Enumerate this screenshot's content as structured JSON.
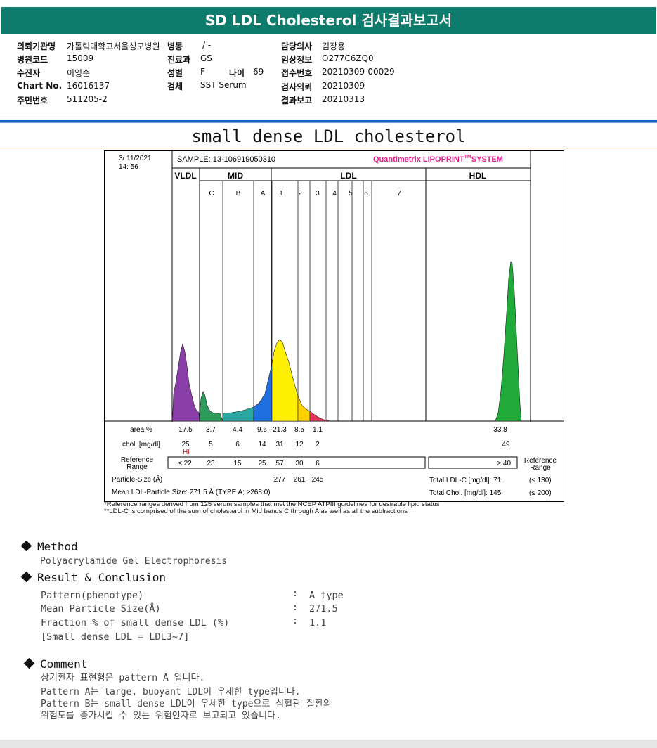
{
  "header": {
    "title": "SD LDL Cholesterol 검사결과보고서"
  },
  "info": {
    "rows": [
      [
        {
          "label": "의뢰기관명",
          "value": "가톨릭대학교서울성모병원"
        },
        {
          "label": "병동",
          "value": "/ -"
        },
        {
          "label": "담당의사",
          "value": "김장용"
        }
      ],
      [
        {
          "label": "병원코드",
          "value": "15009"
        },
        {
          "label": "진료과",
          "value": "GS"
        },
        {
          "label": "임상정보",
          "value": "O277C6ZQ0"
        }
      ],
      [
        {
          "label": "수진자",
          "value": "이영순"
        },
        {
          "label": "성별",
          "value": "F"
        },
        {
          "label": "나이",
          "value": "69"
        },
        {
          "label": "접수번호",
          "value": "20210309-00029"
        }
      ],
      [
        {
          "label": "Chart No.",
          "value": "16016137"
        },
        {
          "label": "검체",
          "value": "SST Serum"
        },
        {
          "label": "검사의뢰",
          "value": "20210309"
        }
      ],
      [
        {
          "label": "주민번호",
          "value": "511205-2"
        },
        {
          "label": "결과보고",
          "value": "20210313"
        }
      ]
    ]
  },
  "subtitle": "small dense LDL cholesterol",
  "report": {
    "date": "3/ 11/2021",
    "time": "14: 56",
    "sample": "SAMPLE:  13-106919050310",
    "brand": "Quantimetrix LIPOPRINT",
    "brand_tm": "TM",
    "brand_system": "SYSTEM",
    "groups": [
      "VLDL",
      "MID",
      "LDL",
      "HDL"
    ],
    "bands": [
      "C",
      "B",
      "A",
      "1",
      "2",
      "3",
      "4",
      "5",
      "6",
      "7"
    ],
    "rows": {
      "area": {
        "label": "area %",
        "values": [
          "17.5",
          "3.7",
          "4.4",
          "9.6",
          "21.3",
          "8.5",
          "1.1"
        ],
        "hdl": "33.8"
      },
      "chol": {
        "label": "chol. [mg/dl]",
        "values": [
          "25",
          "5",
          "6",
          "14",
          "31",
          "12",
          "2"
        ],
        "hdl": "49",
        "flag": "HI"
      },
      "ref": {
        "label1": "Reference",
        "label2": "Range",
        "values": [
          "≤ 22",
          "23",
          "15",
          "25",
          "57",
          "30",
          "6"
        ],
        "hdl": "≥ 40",
        "right1": "Reference",
        "right2": "Range"
      },
      "psize": {
        "label": "Particle-Size (Å)",
        "values": [
          "277",
          "261",
          "245"
        ],
        "ldlc": "Total LDL-C [mg/dl]:  71",
        "ldlc_ref": "(≤ 130)"
      },
      "mean": {
        "label": "Mean LDL-Particle Size:   271.5 Å   (TYPE A; ≥268.0)",
        "tchol": "Total Chol. [mg/dl]:   145",
        "tchol_ref": "(≤ 200)"
      }
    },
    "colors": {
      "vldl": "#8a3fa8",
      "midc": "#2e8b57",
      "midb": "#2aa07a",
      "mida": "#1f6fe0",
      "ldl1": "#ffef00",
      "ldl2": "#ffd400",
      "ldl3": "#e8365a",
      "hdl": "#1faa3a",
      "brand": "#e0218a"
    }
  },
  "footnotes": [
    "*Reference ranges derived from 125 serum samples that met the NCEP ATPIII guidelines for desirable lipid status",
    "**LDL-C is comprised of the sum of cholesterol in Mid bands C through A as well as all the subfractions"
  ],
  "method": {
    "heading": "Method",
    "text": "Polyacrylamide Gel Electrophoresis"
  },
  "result": {
    "heading": "Result & Conclusion",
    "rows": [
      {
        "label": "Pattern(phenotype)",
        "value": "A type"
      },
      {
        "label": "Mean Particle Size(Å)",
        "value": "271.5"
      },
      {
        "label": "Fraction % of small dense LDL (%)",
        "value": "1.1"
      }
    ],
    "note": "[Small dense LDL = LDL3~7]"
  },
  "comment": {
    "heading": "Comment",
    "lines": [
      "상기환자 표현형은 pattern A 입니다.",
      "Pattern A는 large, buoyant LDL이 우세한 type입니다.",
      "Pattern B는 small dense LDL이 우세한 type으로 심혈관 질환의",
      "위험도를 증가시킬 수 있는 위험인자로 보고되고 있습니다."
    ]
  }
}
